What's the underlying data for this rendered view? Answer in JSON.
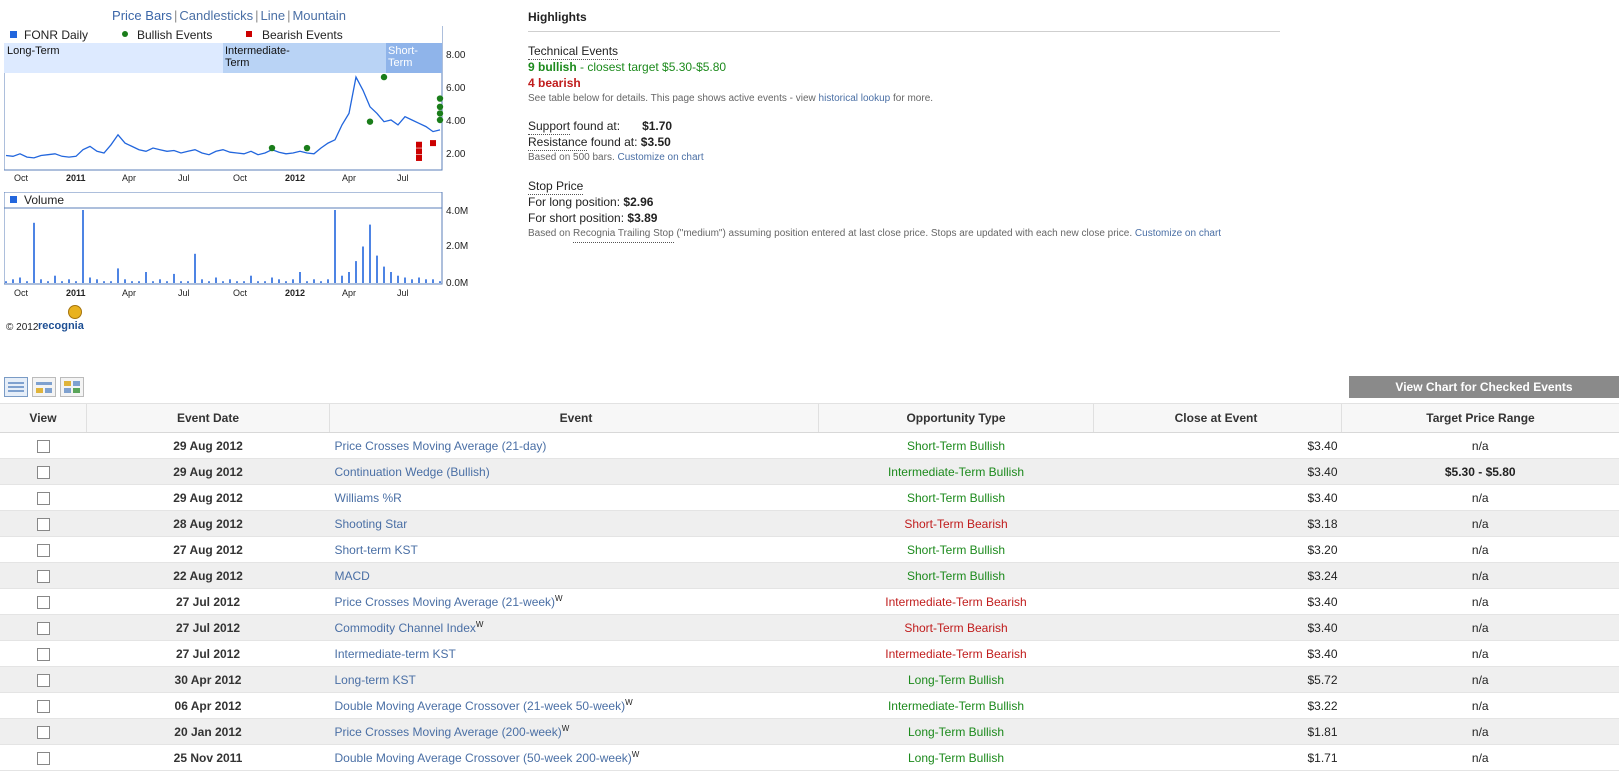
{
  "chart_tabs": [
    "Price Bars",
    "Candlesticks",
    "Line",
    "Mountain"
  ],
  "chart": {
    "legend": {
      "series": "FONR Daily",
      "bullish": "Bullish Events",
      "bearish": "Bearish Events"
    },
    "terms": {
      "long": "Long-Term",
      "intermediate_1": "Intermediate-",
      "intermediate_2": "Term",
      "short_1": "Short-",
      "short_2": "Term"
    },
    "x_ticks": [
      "Oct",
      "2011",
      "Apr",
      "Jul",
      "Oct",
      "2012",
      "Apr",
      "Jul"
    ],
    "price_ticks": [
      "8.00",
      "6.00",
      "4.00",
      "2.00"
    ],
    "volume_label": "Volume",
    "volume_ticks": [
      "4.0M",
      "2.0M",
      "0.0M"
    ],
    "copyright": "© 2012",
    "brand": "recognia",
    "colors": {
      "line": "#2266dd",
      "bullish": "#1a7d1a",
      "bearish": "#cc0000",
      "long_band": "#ddeaff",
      "int_band": "#b9d3f5",
      "short_band": "#8fb4ea"
    }
  },
  "chart_data": [
    {
      "type": "line",
      "title": "",
      "series": [
        {
          "name": "FONR Daily",
          "values": [
            1.85,
            1.8,
            1.95,
            1.75,
            1.7,
            1.85,
            1.9,
            1.95,
            1.8,
            1.75,
            1.8,
            2.2,
            2.4,
            2.1,
            2.0,
            2.5,
            3.1,
            2.6,
            2.4,
            2.2,
            2.1,
            2.3,
            2.2,
            2.1,
            2.15,
            2.0,
            2.1,
            2.2,
            2.0,
            1.9,
            2.1,
            2.2,
            2.05,
            2.0,
            1.95,
            2.1,
            1.9,
            2.0,
            2.2,
            2.05,
            1.95,
            2.0,
            2.1,
            2.0,
            1.95,
            2.3,
            2.6,
            2.8,
            3.7,
            4.4,
            6.6,
            5.8,
            4.8,
            4.4,
            3.9,
            4.0,
            3.7,
            4.2,
            4.0,
            3.8,
            3.6,
            3.3,
            3.4
          ]
        }
      ],
      "y_ticks": [
        8.0,
        6.0,
        4.0,
        2.0
      ],
      "ylim": [
        1.3,
        8.5
      ],
      "x_ticks": [
        "Oct",
        "2011",
        "Apr",
        "Jul",
        "Oct",
        "2012",
        "Apr",
        "Jul"
      ],
      "bullish_events": [
        {
          "index": 38,
          "y": 2.3
        },
        {
          "index": 43,
          "y": 2.3
        },
        {
          "index": 52,
          "y": 3.9
        },
        {
          "index": 54,
          "y": 6.6
        },
        {
          "index": 62,
          "y": 4.0
        },
        {
          "index": 62,
          "y": 4.4
        },
        {
          "index": 62,
          "y": 4.8
        },
        {
          "index": 62,
          "y": 5.3
        }
      ],
      "bearish_events": [
        {
          "index": 59,
          "y": 2.1
        },
        {
          "index": 59,
          "y": 1.7
        },
        {
          "index": 59,
          "y": 2.5
        },
        {
          "index": 61,
          "y": 2.6
        }
      ]
    },
    {
      "type": "bar",
      "series": [
        {
          "name": "Volume",
          "values": [
            0.1,
            0.2,
            0.3,
            0.1,
            3.3,
            0.2,
            0.1,
            0.4,
            0.1,
            0.2,
            0.1,
            4.0,
            0.3,
            0.2,
            0.1,
            0.1,
            0.8,
            0.2,
            0.1,
            0.1,
            0.6,
            0.1,
            0.2,
            0.1,
            0.5,
            0.1,
            0.1,
            1.6,
            0.2,
            0.1,
            0.3,
            0.1,
            0.2,
            0.1,
            0.1,
            0.4,
            0.1,
            0.1,
            0.3,
            0.2,
            0.1,
            0.2,
            0.6,
            0.1,
            0.2,
            0.1,
            0.2,
            4.0,
            0.4,
            0.6,
            1.2,
            2.0,
            3.2,
            1.5,
            0.9,
            0.6,
            0.4,
            0.3,
            0.2,
            0.3,
            0.2,
            0.2,
            0.1
          ]
        }
      ],
      "y_ticks": [
        "4.0M",
        "2.0M",
        "0.0M"
      ],
      "ylim": [
        0,
        4.2
      ]
    }
  ],
  "highlights": {
    "title": "Highlights",
    "technical_events_label": "Technical Events",
    "bullish_count": "9 bullish",
    "closest_target": " - closest target $5.30-$5.80",
    "bearish_count": "4 bearish",
    "details_note": "See table below for details. This page shows active events - view ",
    "historical_lookup": "historical lookup",
    "details_note_end": " for more.",
    "support_label": "Support",
    "support_found": " found at:",
    "support_value": "$1.70",
    "resistance_label": "Resistance",
    "resistance_found": " found at:",
    "resistance_value": "$3.50",
    "based_on_bars": "Based on 500 bars. ",
    "customize_on_chart": "Customize on chart",
    "stop_price_label": "Stop Price",
    "long_position_label": "For long position:",
    "long_position_value": "$2.96",
    "short_position_label": "For short position:",
    "short_position_value": "$3.89",
    "stop_note_start": "Based on ",
    "trailing_stop": "Recognia Trailing Stop",
    "stop_note_end": " (\"medium\") assuming position entered at last close price. Stops are updated with each new close price. ",
    "customize_on_chart_2": "Customize on chart"
  },
  "toolbar": {
    "view_chart_button": "View Chart for Checked Events"
  },
  "table": {
    "headers": [
      "View",
      "Event Date",
      "Event",
      "Opportunity Type",
      "Close at Event",
      "Target Price Range"
    ],
    "rows": [
      {
        "date": "29 Aug 2012",
        "event": "Price Crosses Moving Average (21-day)",
        "sup": "",
        "opportunity": "Short-Term Bullish",
        "close": "$3.40",
        "target": "n/a"
      },
      {
        "date": "29 Aug 2012",
        "event": "Continuation Wedge (Bullish)",
        "sup": "",
        "opportunity": "Intermediate-Term Bullish",
        "close": "$3.40",
        "target": "$5.30 - $5.80"
      },
      {
        "date": "29 Aug 2012",
        "event": "Williams %R",
        "sup": "",
        "opportunity": "Short-Term Bullish",
        "close": "$3.40",
        "target": "n/a"
      },
      {
        "date": "28 Aug 2012",
        "event": "Shooting Star",
        "sup": "",
        "opportunity": "Short-Term Bearish",
        "close": "$3.18",
        "target": "n/a"
      },
      {
        "date": "27 Aug 2012",
        "event": "Short-term KST",
        "sup": "",
        "opportunity": "Short-Term Bullish",
        "close": "$3.20",
        "target": "n/a"
      },
      {
        "date": "22 Aug 2012",
        "event": "MACD",
        "sup": "",
        "opportunity": "Short-Term Bullish",
        "close": "$3.24",
        "target": "n/a"
      },
      {
        "date": "27 Jul 2012",
        "event": "Price Crosses Moving Average (21-week)",
        "sup": "W",
        "opportunity": "Intermediate-Term Bearish",
        "close": "$3.40",
        "target": "n/a"
      },
      {
        "date": "27 Jul 2012",
        "event": "Commodity Channel Index",
        "sup": "W",
        "opportunity": "Short-Term Bearish",
        "close": "$3.40",
        "target": "n/a"
      },
      {
        "date": "27 Jul 2012",
        "event": "Intermediate-term KST",
        "sup": "",
        "opportunity": "Intermediate-Term Bearish",
        "close": "$3.40",
        "target": "n/a"
      },
      {
        "date": "30 Apr 2012",
        "event": "Long-term KST",
        "sup": "",
        "opportunity": "Long-Term Bullish",
        "close": "$5.72",
        "target": "n/a"
      },
      {
        "date": "06 Apr 2012",
        "event": "Double Moving Average Crossover (21-week 50-week)",
        "sup": "W",
        "opportunity": "Intermediate-Term Bullish",
        "close": "$3.22",
        "target": "n/a"
      },
      {
        "date": "20 Jan 2012",
        "event": "Price Crosses Moving Average (200-week)",
        "sup": "W",
        "opportunity": "Long-Term Bullish",
        "close": "$1.81",
        "target": "n/a"
      },
      {
        "date": "25 Nov 2011",
        "event": "Double Moving Average Crossover (50-week 200-week)",
        "sup": "W",
        "opportunity": "Long-Term Bullish",
        "close": "$1.71",
        "target": "n/a"
      }
    ]
  }
}
